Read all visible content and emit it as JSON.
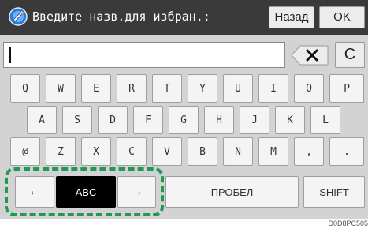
{
  "header": {
    "title": "Введите назв.для избран.:",
    "back_label": "Назад",
    "ok_label": "OK"
  },
  "input": {
    "value": ""
  },
  "controls": {
    "clear_label": "C"
  },
  "keyboard": {
    "row1": [
      "Q",
      "W",
      "E",
      "R",
      "T",
      "Y",
      "U",
      "I",
      "O",
      "P"
    ],
    "row2": [
      "A",
      "S",
      "D",
      "F",
      "G",
      "H",
      "J",
      "K",
      "L"
    ],
    "row3": [
      "@",
      "Z",
      "X",
      "C",
      "V",
      "B",
      "N",
      "M",
      ",",
      "."
    ],
    "bottom": {
      "left_arrow": "←",
      "mode": "ABC",
      "right_arrow": "→",
      "space": "ПРОБЕЛ",
      "shift": "SHIFT"
    }
  },
  "footer_code": "D0D8PC505",
  "colors": {
    "header_bg": "#3a3a3a",
    "highlight_frame": "#1f9a4e",
    "active_key": "#000000"
  }
}
